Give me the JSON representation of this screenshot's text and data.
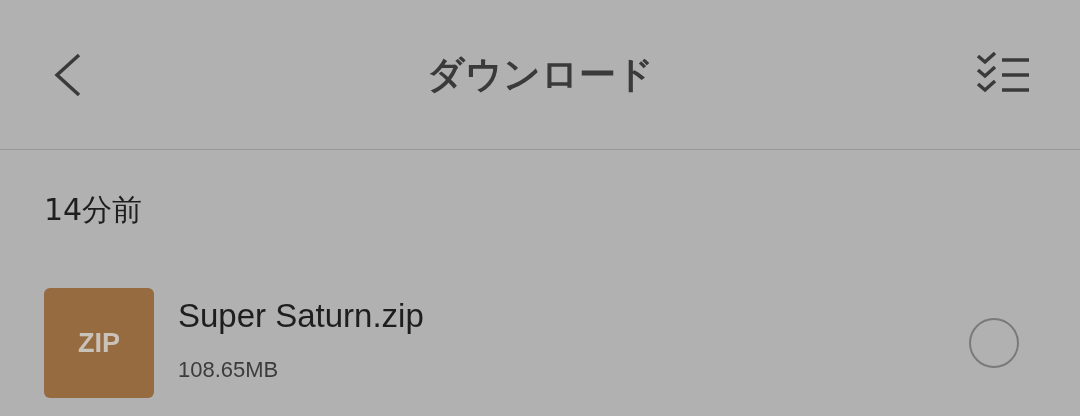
{
  "header": {
    "title": "ダウンロード"
  },
  "groups": [
    {
      "label": "14分前",
      "files": [
        {
          "name": "Super Saturn.zip",
          "size": "108.65MB",
          "type_label": "ZIP",
          "color": "#966b40",
          "selected": false
        }
      ]
    }
  ]
}
